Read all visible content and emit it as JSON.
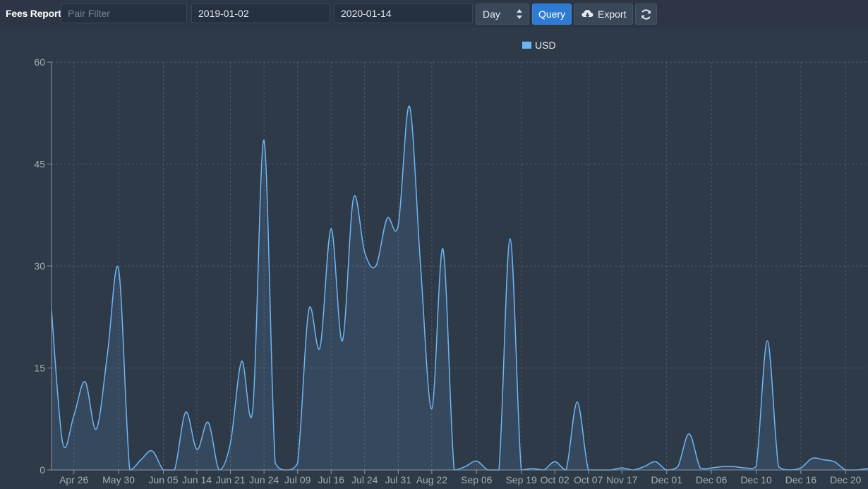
{
  "toolbar": {
    "title": "Fees Report",
    "pair_filter_placeholder": "Pair Filter",
    "pair_filter_value": "",
    "date_from": "2019-01-02",
    "date_to": "2020-01-14",
    "interval": "Day",
    "query_label": "Query",
    "export_label": "Export",
    "icons": {
      "export": "cloud-download-icon",
      "refresh": "refresh-icon",
      "interval": "sort-carets-icon"
    }
  },
  "colors": {
    "background": "#2f3a48",
    "series": "#6cb6f5",
    "accent": "#2f7bd2",
    "grid": "#4d5a6a"
  },
  "chart_data": {
    "type": "area",
    "title": "",
    "xlabel": "",
    "ylabel": "",
    "ylim": [
      0,
      60
    ],
    "yticks": [
      0,
      15,
      30,
      45,
      60
    ],
    "grid": true,
    "legend_placement": "top-center",
    "series": [
      {
        "name": "USD",
        "color": "#6cb6f5",
        "values": [
          23.5,
          4,
          8,
          13,
          6,
          17,
          29.5,
          0,
          1.5,
          2.8,
          0,
          0,
          8.5,
          3,
          7,
          0,
          4,
          16,
          9,
          48.5,
          1,
          0,
          1,
          23.5,
          18,
          35.5,
          19,
          40,
          32,
          30,
          37,
          36,
          53.5,
          30,
          9,
          32.5,
          0,
          0.5,
          1.3,
          0,
          0,
          34,
          0,
          0.2,
          0,
          1.2,
          0,
          10,
          0,
          0,
          0,
          0.3,
          0,
          0.5,
          1.2,
          0,
          0.5,
          5.3,
          0.3,
          0.3,
          0.5,
          0.5,
          0.3,
          0.5,
          19,
          0.5,
          0,
          0.3,
          1.7,
          1.5,
          1.2,
          0,
          0,
          0.2
        ]
      }
    ],
    "x_tick_labels": [
      "Apr 26",
      "May 30",
      "Jun 05",
      "Jun 14",
      "Jun 21",
      "Jun 24",
      "Jul 09",
      "Jul 16",
      "Jul 24",
      "Jul 31",
      "Aug 22",
      "Sep 06",
      "Sep 19",
      "Oct 02",
      "Oct 07",
      "Nov 17",
      "Dec 01",
      "Dec 06",
      "Dec 10",
      "Dec 16",
      "Dec 20"
    ],
    "x_tick_positions": [
      2,
      6,
      10,
      13,
      16,
      19,
      22,
      25,
      28,
      31,
      34,
      38,
      42,
      45,
      48,
      51,
      55,
      59,
      63,
      67,
      71
    ]
  }
}
